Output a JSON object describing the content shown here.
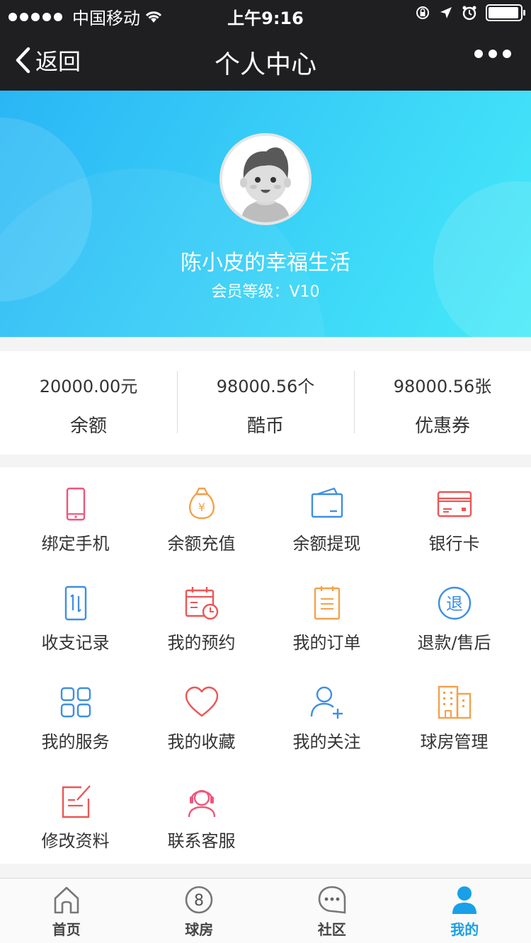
{
  "status_bar": {
    "carrier": "中国移动",
    "time": "上午9:16"
  },
  "nav": {
    "back_label": "返回",
    "title": "个人中心"
  },
  "profile": {
    "name": "陈小皮的幸福生活",
    "level": "会员等级：V10"
  },
  "stats": [
    {
      "value": "20000.00元",
      "label": "余额"
    },
    {
      "value": "98000.56个",
      "label": "酷币"
    },
    {
      "value": "98000.56张",
      "label": "优惠券"
    }
  ],
  "menu": [
    {
      "label": "绑定手机",
      "icon": "phone-icon",
      "color": "#f0557a"
    },
    {
      "label": "余额充值",
      "icon": "money-bag-icon",
      "color": "#f5a04a"
    },
    {
      "label": "余额提现",
      "icon": "wallet-icon",
      "color": "#3d8fe5"
    },
    {
      "label": "银行卡",
      "icon": "bank-card-icon",
      "color": "#ee5555"
    },
    {
      "label": "收支记录",
      "icon": "records-icon",
      "color": "#3d8fe5"
    },
    {
      "label": "我的预约",
      "icon": "calendar-icon",
      "color": "#ee5555"
    },
    {
      "label": "我的订单",
      "icon": "order-icon",
      "color": "#f5a04a"
    },
    {
      "label": "退款/售后",
      "icon": "refund-icon",
      "color": "#3d8fe5",
      "glyph": "退"
    },
    {
      "label": "我的服务",
      "icon": "services-grid-icon",
      "color": "#3d8fe5"
    },
    {
      "label": "我的收藏",
      "icon": "heart-icon",
      "color": "#ee5555"
    },
    {
      "label": "我的关注",
      "icon": "follow-user-icon",
      "color": "#3d8fe5"
    },
    {
      "label": "球房管理",
      "icon": "building-icon",
      "color": "#f5a04a"
    },
    {
      "label": "修改资料",
      "icon": "edit-icon",
      "color": "#ee5555"
    },
    {
      "label": "联系客服",
      "icon": "headset-icon",
      "color": "#f0557a"
    }
  ],
  "tabs": [
    {
      "label": "首页",
      "icon": "home-icon"
    },
    {
      "label": "球房",
      "icon": "ball-8-icon",
      "glyph": "8"
    },
    {
      "label": "社区",
      "icon": "chat-icon"
    },
    {
      "label": "我的",
      "icon": "user-icon",
      "active": true
    }
  ],
  "colors": {
    "accent": "#18a0e8",
    "nav_bg": "#1f1f21",
    "header_start": "#2ab6f5",
    "header_end": "#46eaf8"
  }
}
